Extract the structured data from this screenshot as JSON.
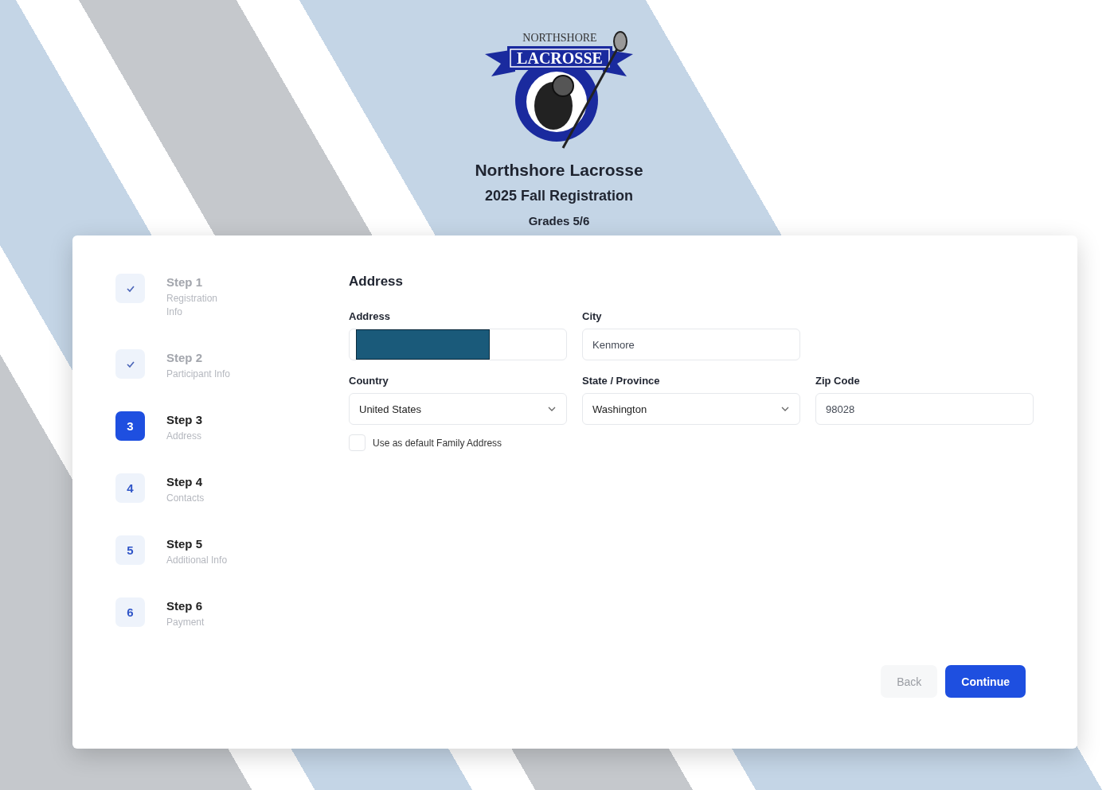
{
  "logo": {
    "top_text": "NORTHSHORE",
    "banner_text": "LACROSSE"
  },
  "header": {
    "title": "Northshore Lacrosse",
    "subtitle": "2025 Fall Registration",
    "grades": "Grades 5/6"
  },
  "steps": [
    {
      "label": "Step 1",
      "description": "Registration Info",
      "completed": true,
      "selected": false
    },
    {
      "label": "Step 2",
      "description": "Participant Info",
      "completed": true,
      "selected": false
    },
    {
      "label": "Step 3",
      "description": "Address",
      "completed": false,
      "selected": true,
      "number": "3"
    },
    {
      "label": "Step 4",
      "description": "Contacts",
      "completed": false,
      "selected": false,
      "number": "4"
    },
    {
      "label": "Step 5",
      "description": "Additional Info",
      "completed": false,
      "selected": false,
      "number": "5"
    },
    {
      "label": "Step 6",
      "description": "Payment",
      "completed": false,
      "selected": false,
      "number": "6"
    }
  ],
  "form": {
    "heading": "Address",
    "rows": [
      [
        {
          "label": "Address",
          "kind": "redacted"
        },
        {
          "label": "City",
          "kind": "text",
          "value": "Kenmore"
        }
      ],
      [
        {
          "label": "Country",
          "kind": "select",
          "value": "United States"
        },
        {
          "label": "State / Province",
          "kind": "select",
          "value": "Washington"
        },
        {
          "label": "Zip Code",
          "kind": "text",
          "value": "98028"
        }
      ]
    ],
    "default_address": {
      "label": "Use as default Family Address",
      "checked": false
    }
  },
  "buttons": {
    "back": "Back",
    "continue": "Continue"
  }
}
